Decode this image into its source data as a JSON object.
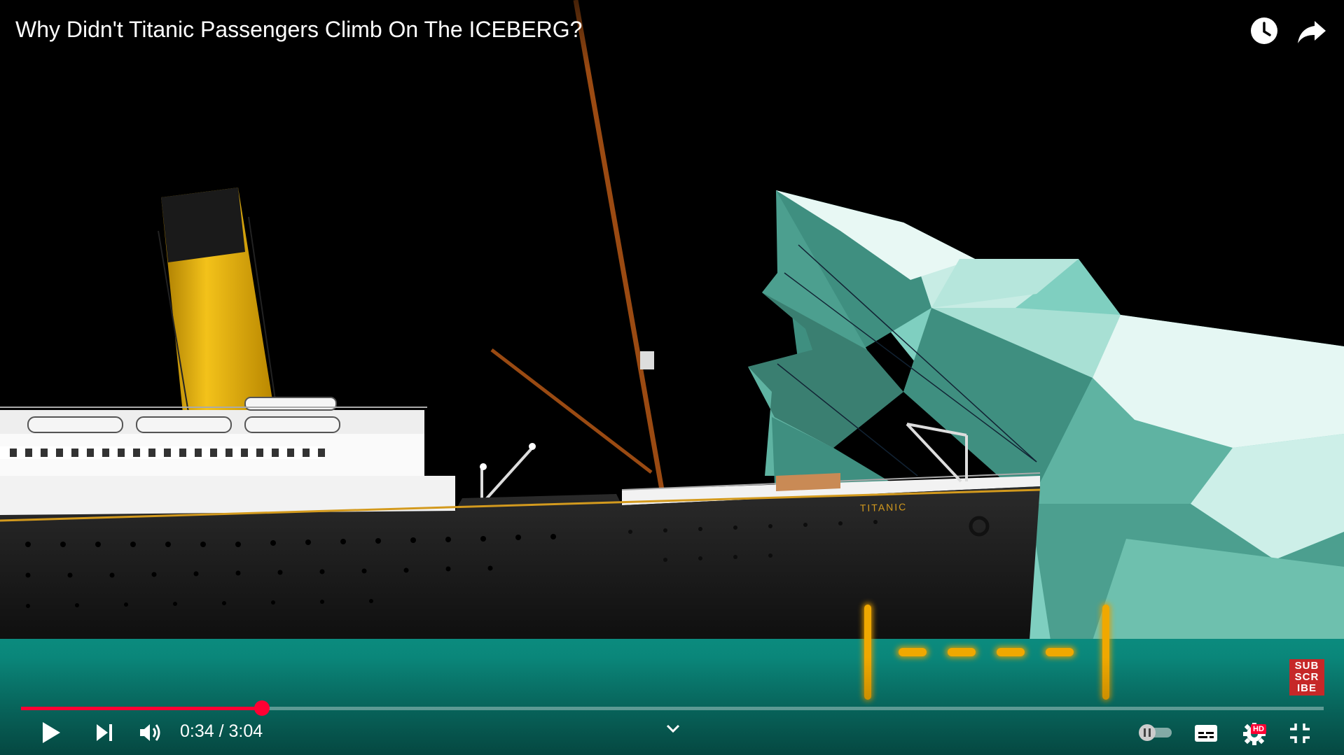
{
  "video": {
    "title": "Why Didn't Titanic Passengers Climb On The ICEBERG?"
  },
  "scene": {
    "ship_name_text": "TITANIC"
  },
  "player": {
    "current_time": "0:34",
    "separator": " / ",
    "duration": "3:04",
    "progress_fraction": 0.185,
    "accent_color": "#ff0033"
  },
  "top_icons": [
    "clock-icon",
    "share-icon"
  ],
  "bottom_icons": [
    "play-icon",
    "next-icon",
    "volume-icon",
    "chevron-down-icon",
    "autoplay-toggle",
    "captions-icon",
    "settings-icon",
    "exit-fullscreen-icon"
  ],
  "subscribe_overlay": {
    "text": "SUB SCR IBE",
    "color": "#c62828"
  },
  "hd_badge": "HD"
}
